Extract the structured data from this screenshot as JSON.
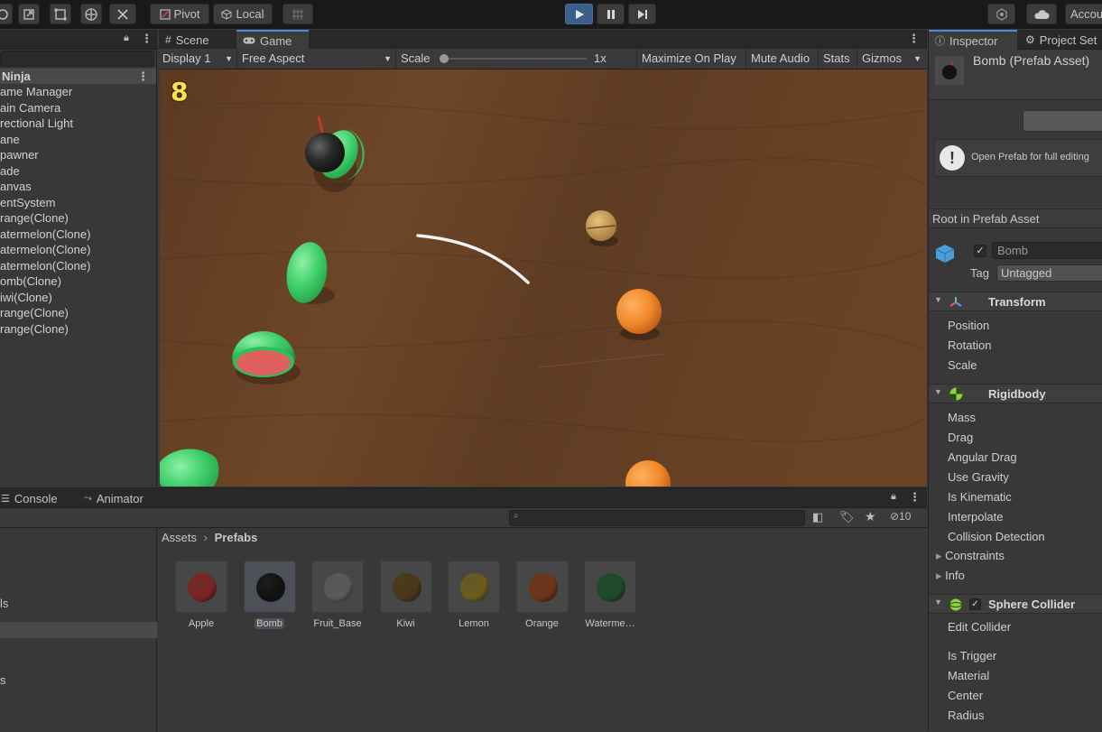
{
  "toolbar": {
    "pivot_label": "Pivot",
    "local_label": "Local",
    "account_label": "Accou"
  },
  "hierarchy": {
    "scene_name": "Ninja",
    "items": [
      "ame Manager",
      "ain Camera",
      "rectional Light",
      "ane",
      "pawner",
      "ade",
      "anvas",
      "entSystem",
      "range(Clone)",
      "atermelon(Clone)",
      "atermelon(Clone)",
      "atermelon(Clone)",
      "omb(Clone)",
      "iwi(Clone)",
      "range(Clone)",
      "range(Clone)"
    ]
  },
  "game": {
    "tab_scene": "Scene",
    "tab_game": "Game",
    "display": "Display 1",
    "aspect": "Free Aspect",
    "scale_label": "Scale",
    "scale_value": "1x",
    "maximize": "Maximize On Play",
    "mute": "Mute Audio",
    "stats": "Stats",
    "gizmos": "Gizmos",
    "score": "8"
  },
  "bottom": {
    "tab_console": "Console",
    "tab_animator": "Animator",
    "hidden_count": "10",
    "breadcrumb_root": "Assets",
    "breadcrumb_current": "Prefabs",
    "left_labels": [
      "ls",
      "s"
    ],
    "assets": [
      {
        "name": "Apple",
        "color": "#7a2424"
      },
      {
        "name": "Bomb",
        "color": "#111111"
      },
      {
        "name": "Fruit_Base",
        "color": "#5a5a5a"
      },
      {
        "name": "Kiwi",
        "color": "#4a3718"
      },
      {
        "name": "Lemon",
        "color": "#6b5c1c"
      },
      {
        "name": "Orange",
        "color": "#6e3416"
      },
      {
        "name": "Waterme…",
        "color": "#1c4a2b"
      }
    ]
  },
  "inspector": {
    "tab_inspector": "Inspector",
    "tab_project_settings": "Project Set",
    "asset_title": "Bomb (Prefab Asset)",
    "open_prefab_msg": "Open Prefab for full editing",
    "root_label": "Root in Prefab Asset",
    "object_name": "Bomb",
    "tag_label": "Tag",
    "tag_value": "Untagged",
    "transform": {
      "title": "Transform",
      "fields": [
        "Position",
        "Rotation",
        "Scale"
      ]
    },
    "rigidbody": {
      "title": "Rigidbody",
      "fields": [
        "Mass",
        "Drag",
        "Angular Drag",
        "Use Gravity",
        "Is Kinematic",
        "Interpolate",
        "Collision Detection"
      ],
      "foldouts": [
        "Constraints",
        "Info"
      ]
    },
    "sphere_collider": {
      "title": "Sphere Collider",
      "edit": "Edit Collider",
      "fields": [
        "Is Trigger",
        "Material",
        "Center",
        "Radius"
      ]
    }
  }
}
